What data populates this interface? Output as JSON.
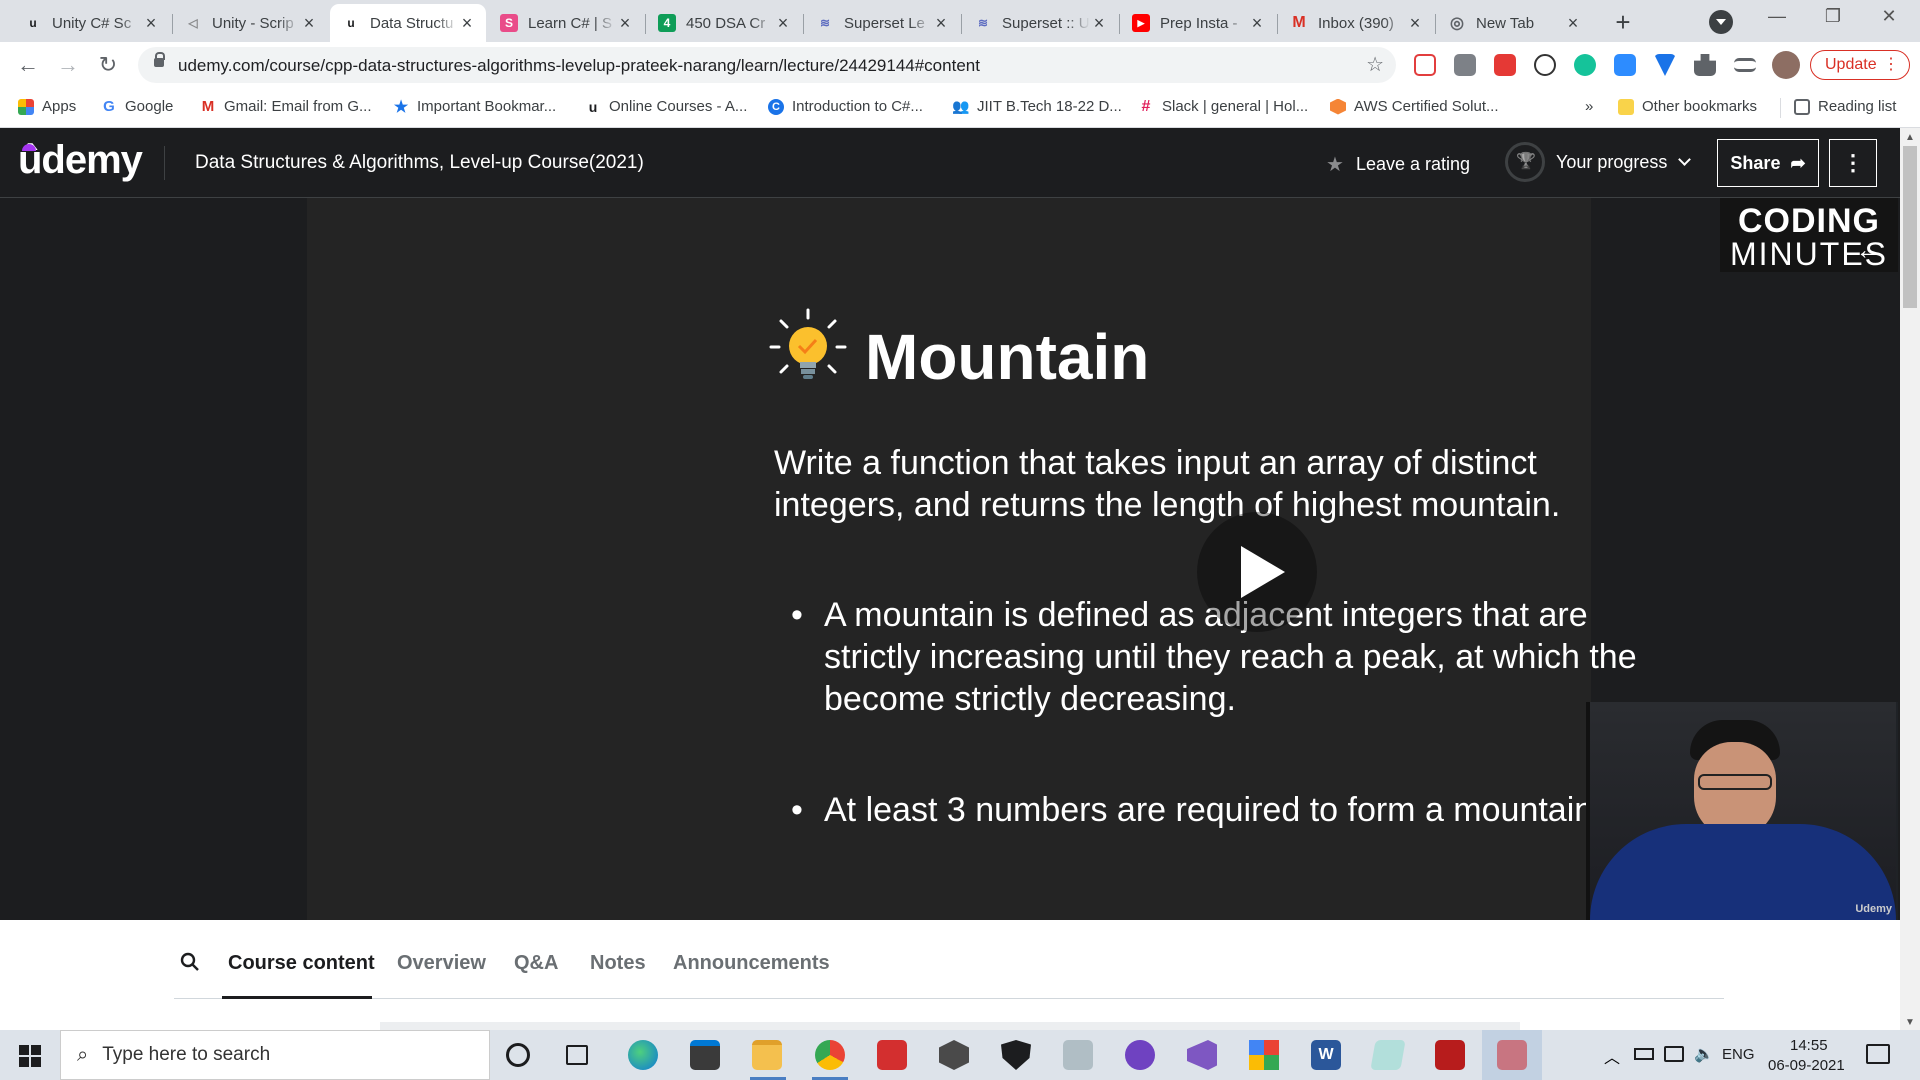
{
  "browser": {
    "tabs": [
      {
        "title": "Unity C# Sc",
        "fav": "u",
        "favcolor": "#1c1d1f"
      },
      {
        "title": "Unity - Scrip",
        "fav": "◁",
        "favcolor": "#8a8b8d"
      },
      {
        "title": "Data Structu",
        "fav": "u",
        "favcolor": "#1c1d1f"
      },
      {
        "title": "Learn C# | S",
        "fav": "S",
        "favcolor": "#e94c89"
      },
      {
        "title": "450 DSA Cr",
        "fav": "4",
        "favcolor": "#0f9d58"
      },
      {
        "title": "Superset Le",
        "fav": "≋",
        "favcolor": "#5c6bc0"
      },
      {
        "title": "Superset :: U",
        "fav": "≋",
        "favcolor": "#5c6bc0"
      },
      {
        "title": "Prep Insta -",
        "fav": "▶",
        "favcolor": "#ff0000"
      },
      {
        "title": "Inbox (390)",
        "fav": "M",
        "favcolor": "#d93025"
      },
      {
        "title": "New Tab",
        "fav": "◎",
        "favcolor": "#5f6368"
      }
    ],
    "url": "udemy.com/course/cpp-data-structures-algorithms-levelup-prateek-narang/learn/lecture/24429144#content",
    "update_label": "Update",
    "bookmarks": [
      {
        "label": "Apps"
      },
      {
        "label": "Google"
      },
      {
        "label": "Gmail: Email from G..."
      },
      {
        "label": "Important Bookmar..."
      },
      {
        "label": "Online Courses - A..."
      },
      {
        "label": "Introduction to C#..."
      },
      {
        "label": "JIIT B.Tech 18-22 D..."
      },
      {
        "label": "Slack | general | Hol..."
      },
      {
        "label": "AWS Certified Solut..."
      }
    ],
    "more_bookmarks": "»",
    "other_bookmarks": "Other bookmarks",
    "reading_list": "Reading list"
  },
  "udemy": {
    "logo": "ûdemy",
    "course_title": "Data Structures & Algorithms, Level-up Course(2021)",
    "leave_rating": "Leave a rating",
    "your_progress": "Your progress",
    "share": "Share",
    "more": "⋮"
  },
  "slide": {
    "brand_line1": "CODING",
    "brand_line2": "MINUTES",
    "title": "Mountain",
    "description": "Write a function that takes input an array of distinct integers, and returns the length of highest mountain.",
    "bullets": [
      "A mountain is defined as adjacent integers that are strictly increasing until they reach a peak, at which the become strictly decreasing.",
      "At least 3 numbers are required to form a mountain."
    ],
    "cam_watermark": "Udemy"
  },
  "course_tabs": {
    "items": [
      "Course content",
      "Overview",
      "Q&A",
      "Notes",
      "Announcements"
    ],
    "active": "Course content"
  },
  "taskbar": {
    "search_placeholder": "Type here to search",
    "language": "ENG",
    "time": "14:55",
    "date": "06-09-2021"
  }
}
